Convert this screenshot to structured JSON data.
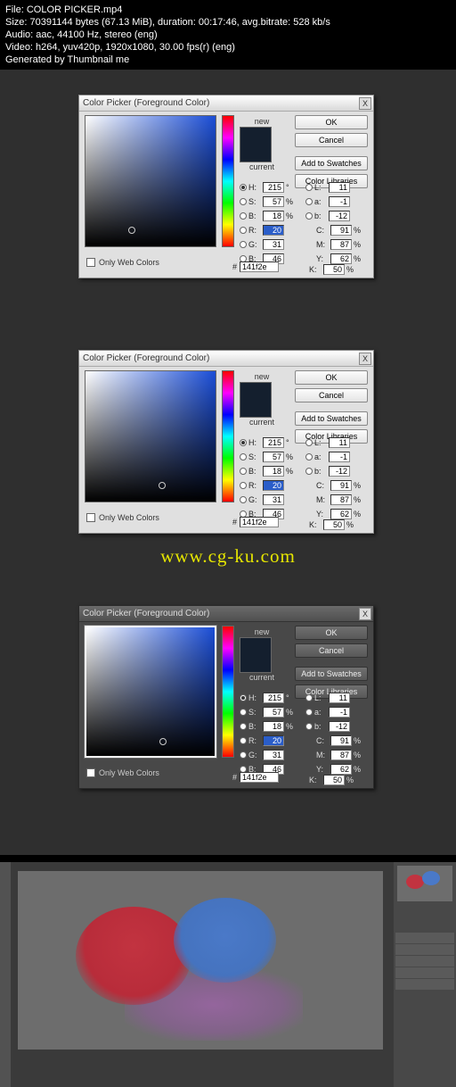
{
  "meta": {
    "l1": "File: COLOR PICKER.mp4",
    "l2": "Size: 70391144 bytes (67.13 MiB), duration: 00:17:46, avg.bitrate: 528 kb/s",
    "l3": "Audio: aac, 44100 Hz, stereo (eng)",
    "l4": "Video: h264, yuv420p, 1920x1080, 30.00 fps(r) (eng)",
    "l5": "Generated by Thumbnail me"
  },
  "watermark": "www.cg-ku.com",
  "dialog": {
    "title": "Color Picker (Foreground Color)",
    "close": "X",
    "new_label": "new",
    "current_label": "current",
    "swatch_new": "#141f2e",
    "swatch_current": "#141f2e",
    "buttons": {
      "ok": "OK",
      "cancel": "Cancel",
      "add": "Add to Swatches",
      "libs": "Color Libraries"
    },
    "web_only": "Only Web Colors",
    "hex_label": "#",
    "hex_value": "141f2e",
    "vals": {
      "H": "215",
      "H_unit": "°",
      "S": "57",
      "S_unit": "%",
      "Bv": "18",
      "Bv_unit": "%",
      "R": "20",
      "G": "31",
      "B": "46",
      "L": "11",
      "a": "-1",
      "b": "-12",
      "C": "91",
      "pct": "%",
      "M": "87",
      "Y": "62",
      "K": "50"
    },
    "labels": {
      "H": "H:",
      "S": "S:",
      "Bv": "B:",
      "R": "R:",
      "G": "G:",
      "B": "B:",
      "L": "L:",
      "a": "a:",
      "b": "b:",
      "C": "C:",
      "M": "M:",
      "Y": "Y:",
      "K": "K:"
    }
  }
}
